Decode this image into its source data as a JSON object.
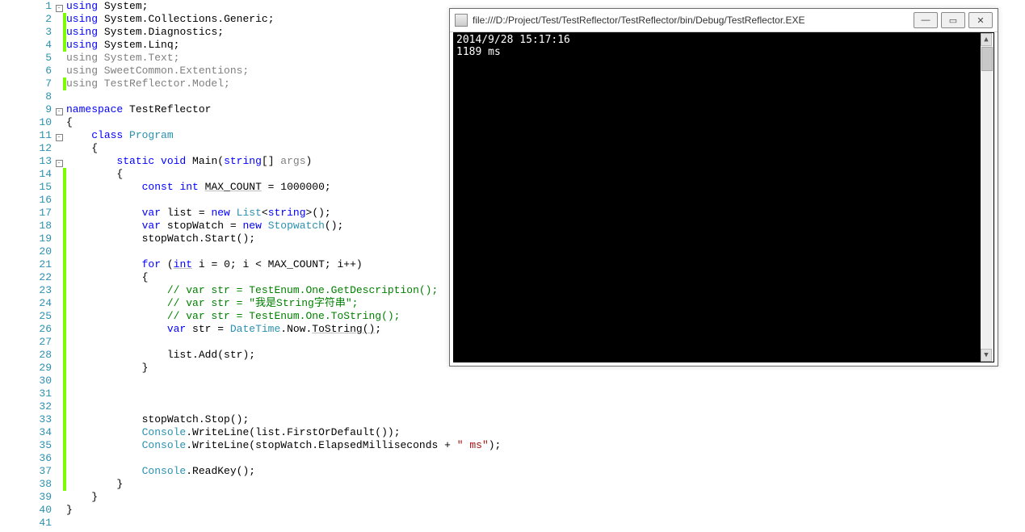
{
  "editor": {
    "lines": [
      {
        "n": 1,
        "fold": "-",
        "changed": false,
        "tokens": [
          {
            "t": "using ",
            "c": "kw"
          },
          {
            "t": "System",
            "c": "black"
          },
          {
            "t": ";",
            "c": "black"
          }
        ]
      },
      {
        "n": 2,
        "fold": "",
        "changed": true,
        "tokens": [
          {
            "t": "using ",
            "c": "kw"
          },
          {
            "t": "System",
            "c": "black"
          },
          {
            "t": ".",
            "c": "black"
          },
          {
            "t": "Collections",
            "c": "black"
          },
          {
            "t": ".",
            "c": "black"
          },
          {
            "t": "Generic",
            "c": "black"
          },
          {
            "t": ";",
            "c": "black"
          }
        ]
      },
      {
        "n": 3,
        "fold": "",
        "changed": true,
        "tokens": [
          {
            "t": "using ",
            "c": "kw"
          },
          {
            "t": "System",
            "c": "black"
          },
          {
            "t": ".",
            "c": "black"
          },
          {
            "t": "Diagnostics",
            "c": "black"
          },
          {
            "t": ";",
            "c": "black"
          }
        ]
      },
      {
        "n": 4,
        "fold": "",
        "changed": true,
        "tokens": [
          {
            "t": "using ",
            "c": "kw"
          },
          {
            "t": "System",
            "c": "black"
          },
          {
            "t": ".",
            "c": "black"
          },
          {
            "t": "Linq",
            "c": "black"
          },
          {
            "t": ";",
            "c": "black"
          }
        ]
      },
      {
        "n": 5,
        "fold": "",
        "changed": false,
        "tokens": [
          {
            "t": "using System.Text;",
            "c": "faded"
          }
        ]
      },
      {
        "n": 6,
        "fold": "",
        "changed": false,
        "tokens": [
          {
            "t": "using SweetCommon.Extentions;",
            "c": "faded"
          }
        ]
      },
      {
        "n": 7,
        "fold": "",
        "changed": true,
        "tokens": [
          {
            "t": "using TestReflector.Model;",
            "c": "faded"
          }
        ]
      },
      {
        "n": 8,
        "fold": "",
        "changed": false,
        "tokens": []
      },
      {
        "n": 9,
        "fold": "-",
        "changed": false,
        "tokens": [
          {
            "t": "namespace ",
            "c": "kw"
          },
          {
            "t": "TestReflector",
            "c": "black"
          }
        ]
      },
      {
        "n": 10,
        "fold": "",
        "changed": false,
        "tokens": [
          {
            "t": "{",
            "c": "black"
          }
        ]
      },
      {
        "n": 11,
        "fold": "-",
        "changed": false,
        "tokens": [
          {
            "t": "    ",
            "c": ""
          },
          {
            "t": "class ",
            "c": "kw"
          },
          {
            "t": "Program",
            "c": "type"
          }
        ]
      },
      {
        "n": 12,
        "fold": "",
        "changed": false,
        "tokens": [
          {
            "t": "    {",
            "c": "black"
          }
        ]
      },
      {
        "n": 13,
        "fold": "-",
        "changed": false,
        "tokens": [
          {
            "t": "        ",
            "c": ""
          },
          {
            "t": "static ",
            "c": "kw"
          },
          {
            "t": "void ",
            "c": "kw"
          },
          {
            "t": "Main",
            "c": "black"
          },
          {
            "t": "(",
            "c": "black"
          },
          {
            "t": "string",
            "c": "kw"
          },
          {
            "t": "[] ",
            "c": "black"
          },
          {
            "t": "args",
            "c": "faded"
          },
          {
            "t": ")",
            "c": "black"
          }
        ]
      },
      {
        "n": 14,
        "fold": "",
        "changed": true,
        "tokens": [
          {
            "t": "        {",
            "c": "black"
          }
        ]
      },
      {
        "n": 15,
        "fold": "",
        "changed": true,
        "tokens": [
          {
            "t": "            ",
            "c": ""
          },
          {
            "t": "const ",
            "c": "kw"
          },
          {
            "t": "int ",
            "c": "kw"
          },
          {
            "t": "MAX_COUNT",
            "c": "black underline"
          },
          {
            "t": " = 1000000;",
            "c": "black"
          }
        ]
      },
      {
        "n": 16,
        "fold": "",
        "changed": true,
        "tokens": []
      },
      {
        "n": 17,
        "fold": "",
        "changed": true,
        "tokens": [
          {
            "t": "            ",
            "c": ""
          },
          {
            "t": "var ",
            "c": "kw"
          },
          {
            "t": "list = ",
            "c": "black"
          },
          {
            "t": "new ",
            "c": "kw"
          },
          {
            "t": "List",
            "c": "type"
          },
          {
            "t": "<",
            "c": "black"
          },
          {
            "t": "string",
            "c": "kw"
          },
          {
            "t": ">();",
            "c": "black"
          }
        ]
      },
      {
        "n": 18,
        "fold": "",
        "changed": true,
        "tokens": [
          {
            "t": "            ",
            "c": ""
          },
          {
            "t": "var ",
            "c": "kw"
          },
          {
            "t": "stopWatch = ",
            "c": "black"
          },
          {
            "t": "new ",
            "c": "kw"
          },
          {
            "t": "Stopwatch",
            "c": "type"
          },
          {
            "t": "();",
            "c": "black"
          }
        ]
      },
      {
        "n": 19,
        "fold": "",
        "changed": true,
        "tokens": [
          {
            "t": "            stopWatch.",
            "c": "black"
          },
          {
            "t": "Start",
            "c": "black"
          },
          {
            "t": "();",
            "c": "black"
          }
        ]
      },
      {
        "n": 20,
        "fold": "",
        "changed": true,
        "tokens": []
      },
      {
        "n": 21,
        "fold": "",
        "changed": true,
        "tokens": [
          {
            "t": "            ",
            "c": ""
          },
          {
            "t": "for ",
            "c": "kw"
          },
          {
            "t": "(",
            "c": "black"
          },
          {
            "t": "int",
            "c": "kw underline"
          },
          {
            "t": " i = 0; i < MAX_COUNT; i++)",
            "c": "black"
          }
        ]
      },
      {
        "n": 22,
        "fold": "",
        "changed": true,
        "tokens": [
          {
            "t": "            {",
            "c": "black"
          }
        ]
      },
      {
        "n": 23,
        "fold": "",
        "changed": true,
        "tokens": [
          {
            "t": "                ",
            "c": ""
          },
          {
            "t": "// var str = TestEnum.One.GetDescription();",
            "c": "comment"
          }
        ]
      },
      {
        "n": 24,
        "fold": "",
        "changed": true,
        "tokens": [
          {
            "t": "                ",
            "c": ""
          },
          {
            "t": "// var str = \"我是String字符串\";",
            "c": "comment"
          }
        ]
      },
      {
        "n": 25,
        "fold": "",
        "changed": true,
        "tokens": [
          {
            "t": "                ",
            "c": ""
          },
          {
            "t": "// var str = TestEnum.One.ToString();",
            "c": "comment"
          }
        ]
      },
      {
        "n": 26,
        "fold": "",
        "changed": true,
        "tokens": [
          {
            "t": "                ",
            "c": ""
          },
          {
            "t": "var ",
            "c": "kw"
          },
          {
            "t": "str = ",
            "c": "black"
          },
          {
            "t": "DateTime",
            "c": "type"
          },
          {
            "t": ".Now.",
            "c": "black"
          },
          {
            "t": "ToString",
            "c": "black underline"
          },
          {
            "t": "()",
            "c": "black underline"
          },
          {
            "t": ";",
            "c": "black"
          }
        ]
      },
      {
        "n": 27,
        "fold": "",
        "changed": true,
        "tokens": []
      },
      {
        "n": 28,
        "fold": "",
        "changed": true,
        "tokens": [
          {
            "t": "                list.",
            "c": "black"
          },
          {
            "t": "Add",
            "c": "black"
          },
          {
            "t": "(str);",
            "c": "black"
          }
        ]
      },
      {
        "n": 29,
        "fold": "",
        "changed": true,
        "tokens": [
          {
            "t": "            }",
            "c": "black"
          }
        ]
      },
      {
        "n": 30,
        "fold": "",
        "changed": true,
        "tokens": []
      },
      {
        "n": 31,
        "fold": "",
        "changed": true,
        "tokens": []
      },
      {
        "n": 32,
        "fold": "",
        "changed": true,
        "tokens": []
      },
      {
        "n": 33,
        "fold": "",
        "changed": true,
        "tokens": [
          {
            "t": "            stopWatch.",
            "c": "black"
          },
          {
            "t": "Stop",
            "c": "black"
          },
          {
            "t": "();",
            "c": "black"
          }
        ]
      },
      {
        "n": 34,
        "fold": "",
        "changed": true,
        "tokens": [
          {
            "t": "            ",
            "c": ""
          },
          {
            "t": "Console",
            "c": "type"
          },
          {
            "t": ".",
            "c": "black"
          },
          {
            "t": "WriteLine",
            "c": "black"
          },
          {
            "t": "(list.",
            "c": "black"
          },
          {
            "t": "FirstOrDefault",
            "c": "black"
          },
          {
            "t": "());",
            "c": "black"
          }
        ]
      },
      {
        "n": 35,
        "fold": "",
        "changed": true,
        "tokens": [
          {
            "t": "            ",
            "c": ""
          },
          {
            "t": "Console",
            "c": "type"
          },
          {
            "t": ".",
            "c": "black"
          },
          {
            "t": "WriteLine",
            "c": "black"
          },
          {
            "t": "(stopWatch.",
            "c": "black"
          },
          {
            "t": "ElapsedMilliseconds",
            "c": "black"
          },
          {
            "t": " + ",
            "c": "black"
          },
          {
            "t": "\" ms\"",
            "c": "str"
          },
          {
            "t": ");",
            "c": "black"
          }
        ]
      },
      {
        "n": 36,
        "fold": "",
        "changed": true,
        "tokens": []
      },
      {
        "n": 37,
        "fold": "",
        "changed": true,
        "tokens": [
          {
            "t": "            ",
            "c": ""
          },
          {
            "t": "Console",
            "c": "type"
          },
          {
            "t": ".",
            "c": "black"
          },
          {
            "t": "ReadKey",
            "c": "black"
          },
          {
            "t": "();",
            "c": "black"
          }
        ]
      },
      {
        "n": 38,
        "fold": "",
        "changed": true,
        "tokens": [
          {
            "t": "        }",
            "c": "black"
          }
        ]
      },
      {
        "n": 39,
        "fold": "",
        "changed": false,
        "tokens": [
          {
            "t": "    }",
            "c": "black"
          }
        ]
      },
      {
        "n": 40,
        "fold": "",
        "changed": false,
        "tokens": [
          {
            "t": "}",
            "c": "black"
          }
        ]
      },
      {
        "n": 41,
        "fold": "",
        "changed": false,
        "tokens": []
      }
    ]
  },
  "console": {
    "title": "file:///D:/Project/Test/TestReflector/TestReflector/bin/Debug/TestReflector.EXE",
    "output": [
      "2014/9/28 15:17:16",
      "1189 ms"
    ],
    "buttons": {
      "min": "—",
      "max": "▭",
      "close": "✕"
    }
  }
}
